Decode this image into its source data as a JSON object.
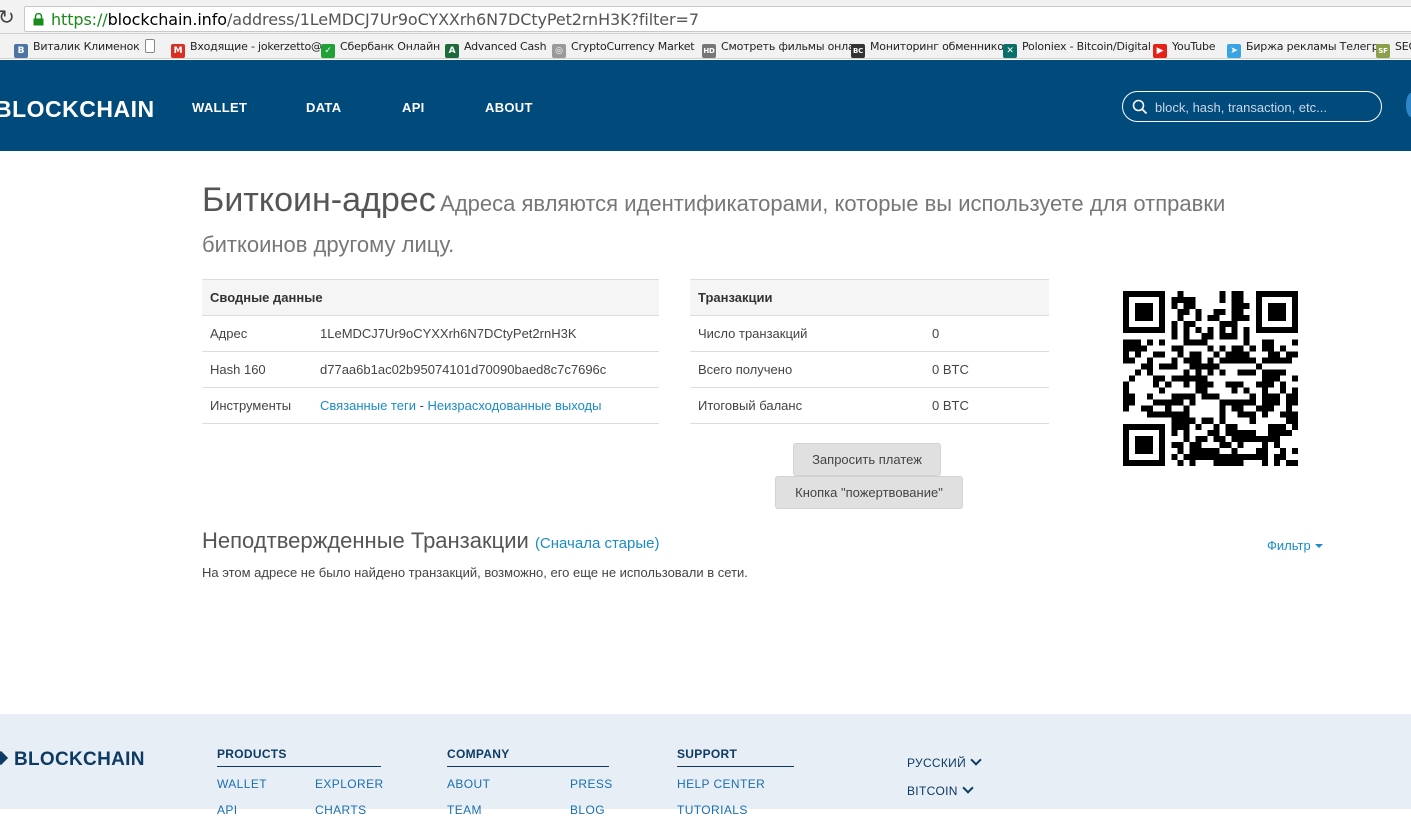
{
  "browser": {
    "url_scheme": "https://",
    "url_host": "blockchain.info",
    "url_path": "/address/1LeMDCJ7Ur9oCYXXrh6N7DCtyPet2rnH3K?filter=7",
    "bookmarks": [
      {
        "label": "Виталик Клименок",
        "icon": "vk-icon",
        "color": "#4c75a3",
        "glyph": "В"
      },
      {
        "label": "",
        "icon": "blank-page-icon",
        "color": "#ffffff",
        "glyph": ""
      },
      {
        "label": "Входящие - jokerzetto@",
        "icon": "gmail-icon",
        "color": "#d93025",
        "glyph": "M"
      },
      {
        "label": "Сбербанк Онлайн",
        "icon": "sberbank-icon",
        "color": "#21a038",
        "glyph": "✓"
      },
      {
        "label": "Advanced Cash",
        "icon": "advcash-icon",
        "color": "#1d6b3a",
        "glyph": "A"
      },
      {
        "label": "CryptoCurrency Market",
        "icon": "coin-icon",
        "color": "#9a9a9a",
        "glyph": "◎"
      },
      {
        "label": "Смотреть фильмы онла",
        "icon": "hd-icon",
        "color": "#777777",
        "glyph": "HD"
      },
      {
        "label": "Мониторинг обменнико",
        "icon": "bc-icon",
        "color": "#333333",
        "glyph": "BC"
      },
      {
        "label": "Poloniex - Bitcoin/Digital",
        "icon": "poloniex-icon",
        "color": "#0b6f69",
        "glyph": "✕"
      },
      {
        "label": "YouTube",
        "icon": "youtube-icon",
        "color": "#e62117",
        "glyph": "▶"
      },
      {
        "label": "Биржа рекламы Телегр",
        "icon": "telegram-icon",
        "color": "#3aa3e3",
        "glyph": "➤"
      },
      {
        "label": "SEO",
        "icon": "seo-icon",
        "color": "#8aa04a",
        "glyph": "SF"
      }
    ]
  },
  "header": {
    "logo": "BLOCKCHAIN",
    "nav": [
      "WALLET",
      "DATA",
      "API",
      "ABOUT"
    ],
    "search_placeholder": "block, hash, transaction, etc..."
  },
  "main": {
    "title": "Биткоин-адрес",
    "subtitle": "Адреса являются идентификаторами, которые вы используете для отправки биткоинов другому лицу.",
    "summary": {
      "heading": "Сводные данные",
      "address_label": "Адрес",
      "address_value": "1LeMDCJ7Ur9oCYXXrh6N7DCtyPet2rnH3K",
      "hash_label": "Hash 160",
      "hash_value": "d77aa6b1ac02b95074101d70090baed8c7c7696c",
      "tools_label": "Инструменты",
      "tools_link1": "Связанные теги",
      "tools_sep": " - ",
      "tools_link2": "Неизрасходованные выходы"
    },
    "transactions": {
      "heading": "Транзакции",
      "count_label": "Число транзакций",
      "count_value": "0",
      "received_label": "Всего получено",
      "received_value": "0 BTC",
      "balance_label": "Итоговый баланс",
      "balance_value": "0 BTC"
    },
    "request_payment_button": "Запросить платеж",
    "donation_button": "Кнопка \"пожертвование\"",
    "unconfirmed_title": "Неподтвержденные Транзакции",
    "unconfirmed_sort": "(Сначала старые)",
    "filter_label": "Фильтр",
    "empty_message": "На этом адресе не было найдено транзакций, возможно, его еще не использовали в сети."
  },
  "footer": {
    "logo": "BLOCKCHAIN",
    "products_heading": "PRODUCTS",
    "products_links": [
      "WALLET",
      "EXPLORER",
      "API",
      "CHARTS"
    ],
    "company_heading": "COMPANY",
    "company_links": [
      "ABOUT",
      "PRESS",
      "TEAM",
      "BLOG"
    ],
    "support_heading": "SUPPORT",
    "support_links": [
      "HELP CENTER",
      "TUTORIALS"
    ],
    "language": "РУССКИЙ",
    "currency": "BITCOIN"
  },
  "colors": {
    "header_bg": "#004a7c",
    "link": "#1a8cc6",
    "btc_green": "#2a8a2a",
    "footer_bg": "#e7eef5"
  }
}
